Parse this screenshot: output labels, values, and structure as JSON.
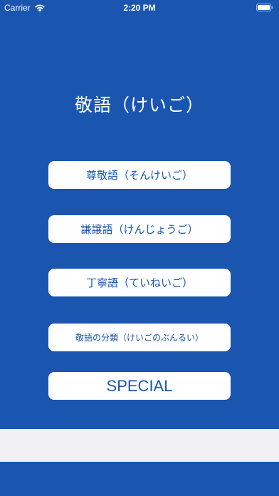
{
  "status_bar": {
    "carrier": "Carrier",
    "time": "2:20 PM"
  },
  "title": "敬語（けいご）",
  "menu": [
    {
      "label": "尊敬語（そんけいご）"
    },
    {
      "label": "謙譲語（けんじょうご）"
    },
    {
      "label": "丁寧語（ていねいご）"
    },
    {
      "label": "敬語の分類（けいごのぶんるい）"
    },
    {
      "label": "SPECIAL"
    }
  ],
  "colors": {
    "background": "#1a56b0",
    "button_bg": "#ffffff",
    "button_text": "#1a56b0",
    "bottom_bar": "#efeff4"
  }
}
